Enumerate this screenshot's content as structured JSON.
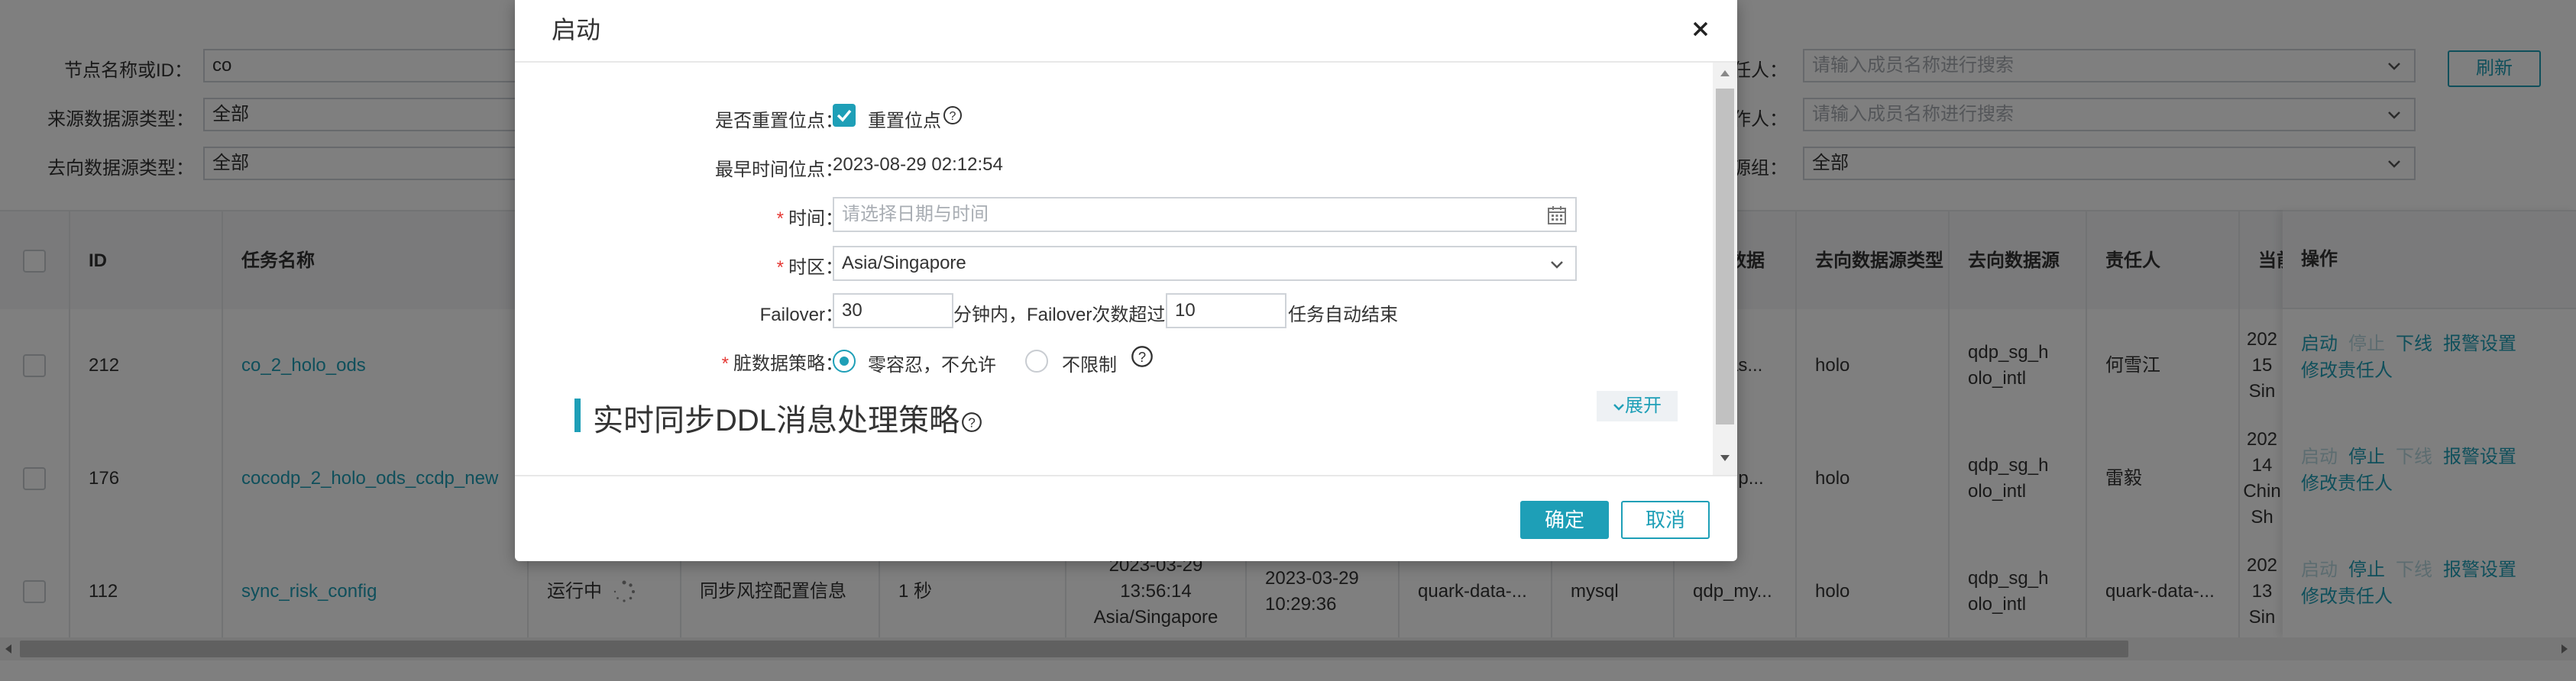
{
  "filters": {
    "node_label": "节点名称或ID：",
    "node_value": "co",
    "source_type_label": "来源数据源类型：",
    "source_type_value": "全部",
    "target_type_label": "去向数据源类型：",
    "target_type_value": "全部",
    "owner_label": "任人：",
    "owner_placeholder": "请输入成员名称进行搜索",
    "operator_label": "作人：",
    "operator_placeholder": "请输入成员名称进行搜索",
    "group_label": "源组：",
    "group_value": "全部",
    "refresh_label": "刷新"
  },
  "table": {
    "headers": {
      "id": "ID",
      "name": "任务名称",
      "dest_partial": "数据",
      "target_type": "去向数据源类型",
      "target": "去向数据源",
      "owner": "责任人",
      "current_partial": "当前",
      "ops": "操作"
    },
    "rows": [
      {
        "id": "212",
        "name": "co_2_holo_ods",
        "status": "",
        "desc": "",
        "delay": "",
        "time1a": "",
        "time1b": "",
        "time1c": "",
        "time2a": "",
        "time2b": "",
        "src": "",
        "src_type": "",
        "dest_partial": "as...",
        "target_type": "holo",
        "target_a": "qdp_sg_h",
        "target_b": "olo_intl",
        "owner": "何雪江",
        "cur_a": "202",
        "cur_b": "15",
        "cur_c": "Sin",
        "op_start": "启动",
        "op_stop": "停止",
        "op_offline": "下线",
        "op_alarm": "报警设置",
        "op_owner": "修改责任人"
      },
      {
        "id": "176",
        "name": "cocodp_2_holo_ods_ccdp_new",
        "status": "",
        "desc": "",
        "delay": "",
        "time1a": "",
        "time1b": "",
        "time1c": "",
        "time2a": "",
        "time2b": "",
        "src": "",
        "src_type": "",
        "dest_partial": "dp...",
        "target_type": "holo",
        "target_a": "qdp_sg_h",
        "target_b": "olo_intl",
        "owner": "雷毅",
        "cur_a": "202",
        "cur_b": "14",
        "cur_c": "Chin",
        "cur_d": "Sh",
        "op_start": "启动",
        "op_stop": "停止",
        "op_offline": "下线",
        "op_alarm": "报警设置",
        "op_owner": "修改责任人"
      },
      {
        "id": "112",
        "name": "sync_risk_config",
        "status": "运行中",
        "desc": "同步风控配置信息",
        "delay": "1 秒",
        "time1a": "2023-03-29",
        "time1b": "13:56:14",
        "time1c": "Asia/Singapore",
        "time2a": "2023-03-29",
        "time2b": "10:29:36",
        "src": "quark-data-...",
        "src_type": "mysql",
        "dest_partial": "qdp_my...",
        "target_type": "holo",
        "target_a": "qdp_sg_h",
        "target_b": "olo_intl",
        "owner": "quark-data-...",
        "cur_a": "202",
        "cur_b": "13",
        "cur_c": "Sin",
        "op_start": "启动",
        "op_stop": "停止",
        "op_offline": "下线",
        "op_alarm": "报警设置",
        "op_owner": "修改责任人"
      }
    ]
  },
  "modal": {
    "title": "启动",
    "reset_label": "是否重置位点：",
    "reset_checkbox_label": "重置位点",
    "earliest_label": "最早时间位点：",
    "earliest_value": "2023-08-29 02:12:54",
    "time_label": "时间：",
    "time_placeholder": "请选择日期与时间",
    "tz_label": "时区：",
    "tz_value": "Asia/Singapore",
    "failover_label": "Failover：",
    "failover_minutes": "30",
    "failover_text1": "分钟内，Failover次数超过",
    "failover_count": "10",
    "failover_text2": "任务自动结束",
    "dirty_label": "脏数据策略：",
    "dirty_opt1": "零容忍，不允许",
    "dirty_opt2": "不限制",
    "ddl_section_title": "实时同步DDL消息处理策略",
    "expand_label": "展开",
    "ok_label": "确定",
    "cancel_label": "取消"
  },
  "colors": {
    "accent": "#1e9fb7",
    "required": "#e53935",
    "mask": "rgba(0,0,0,0.5)"
  }
}
